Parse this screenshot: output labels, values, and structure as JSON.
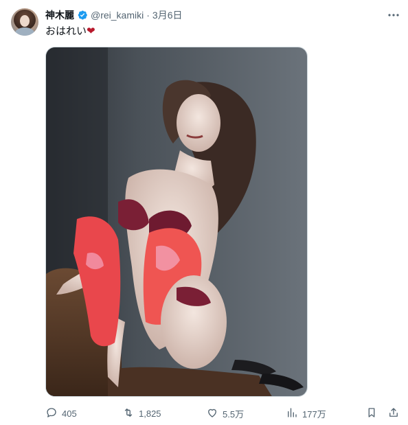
{
  "author": {
    "display_name": "神木麗",
    "handle": "@rei_kamiki",
    "separator": "·",
    "date": "3月6日"
  },
  "post": {
    "text": "おはれい",
    "emoji": "❤"
  },
  "stats": {
    "replies": "405",
    "reposts": "1,825",
    "likes": "5.5万",
    "views": "177万"
  },
  "colors": {
    "verified": "#1d9bf0",
    "heart_emoji": "#b8192c",
    "muted_text": "#536471"
  },
  "icons": [
    "verified-badge-icon",
    "more-icon",
    "reply-icon",
    "repost-icon",
    "like-icon",
    "views-icon",
    "bookmark-icon",
    "share-icon"
  ]
}
